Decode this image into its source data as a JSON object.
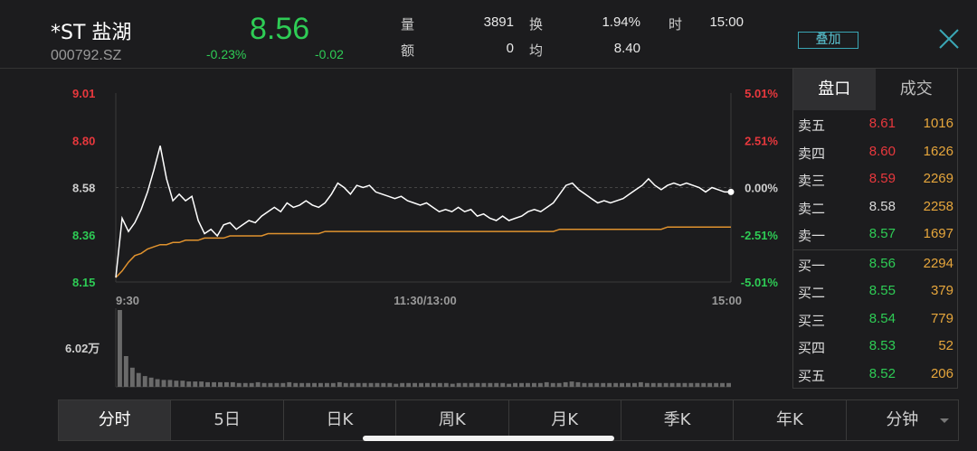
{
  "header": {
    "name": "*ST 盐湖",
    "code": "000792.SZ",
    "price": "8.56",
    "change_pct": "-0.23%",
    "change_abs": "-0.02",
    "stats": {
      "volume_label": "量",
      "volume_value": "3891",
      "amount_label": "额",
      "amount_value": "0",
      "turnover_label": "换",
      "turnover_value": "1.94%",
      "avg_label": "均",
      "avg_value": "8.40",
      "time_label": "时",
      "time_value": "15:00"
    },
    "overlay_label": "叠加"
  },
  "colors": {
    "up": "#e8383d",
    "down": "#2ecc55",
    "neutral": "#d8d8d8",
    "avg_line": "#e0922e",
    "price_line": "#ffffff"
  },
  "chart": {
    "price_ticks": [
      "9.01",
      "8.80",
      "8.58",
      "8.36",
      "8.15"
    ],
    "pct_ticks": [
      "5.01%",
      "2.51%",
      "0.00%",
      "-2.51%",
      "-5.01%"
    ],
    "time_ticks": [
      "9:30",
      "11:30/13:00",
      "15:00"
    ],
    "volume_max_label": "6.02万"
  },
  "chart_data": {
    "type": "line",
    "title": "",
    "xlabel": "",
    "ylabel": "",
    "ylim": [
      8.15,
      9.01
    ],
    "prev_close": 8.58,
    "series": [
      {
        "values": [
          8.17,
          8.44,
          8.38,
          8.42,
          8.48,
          8.56,
          8.66,
          8.77,
          8.62,
          8.52,
          8.55,
          8.52,
          8.54,
          8.43,
          8.37,
          8.39,
          8.36,
          8.41,
          8.42,
          8.39,
          8.41,
          8.43,
          8.42,
          8.45,
          8.47,
          8.49,
          8.47,
          8.51,
          8.49,
          8.5,
          8.52,
          8.5,
          8.49,
          8.51,
          8.55,
          8.6,
          8.58,
          8.55,
          8.59,
          8.58,
          8.59,
          8.56,
          8.55,
          8.54,
          8.53,
          8.54,
          8.52,
          8.51,
          8.5,
          8.51,
          8.49,
          8.47,
          8.48,
          8.47,
          8.49,
          8.47,
          8.48,
          8.45,
          8.46,
          8.44,
          8.43,
          8.45,
          8.43,
          8.44,
          8.45,
          8.47,
          8.48,
          8.47,
          8.49,
          8.51,
          8.55,
          8.59,
          8.6,
          8.57,
          8.55,
          8.53,
          8.51,
          8.52,
          8.51,
          8.52,
          8.53,
          8.55,
          8.57,
          8.59,
          8.62,
          8.59,
          8.57,
          8.59,
          8.6,
          8.59,
          8.6,
          8.59,
          8.58,
          8.56,
          8.58,
          8.57,
          8.56,
          8.56
        ]
      },
      {
        "values": [
          8.17,
          8.2,
          8.24,
          8.27,
          8.28,
          8.3,
          8.31,
          8.32,
          8.32,
          8.33,
          8.33,
          8.34,
          8.34,
          8.34,
          8.35,
          8.35,
          8.35,
          8.35,
          8.36,
          8.36,
          8.36,
          8.36,
          8.36,
          8.36,
          8.37,
          8.37,
          8.37,
          8.37,
          8.37,
          8.37,
          8.37,
          8.37,
          8.37,
          8.38,
          8.38,
          8.38,
          8.38,
          8.38,
          8.38,
          8.38,
          8.38,
          8.38,
          8.38,
          8.38,
          8.38,
          8.38,
          8.38,
          8.38,
          8.38,
          8.38,
          8.38,
          8.38,
          8.38,
          8.38,
          8.38,
          8.38,
          8.38,
          8.38,
          8.38,
          8.38,
          8.38,
          8.38,
          8.38,
          8.38,
          8.38,
          8.38,
          8.38,
          8.38,
          8.38,
          8.38,
          8.39,
          8.39,
          8.39,
          8.39,
          8.39,
          8.39,
          8.39,
          8.39,
          8.39,
          8.39,
          8.39,
          8.39,
          8.39,
          8.39,
          8.39,
          8.39,
          8.39,
          8.4,
          8.4,
          8.4,
          8.4,
          8.4,
          8.4,
          8.4,
          8.4,
          8.4,
          8.4,
          8.4
        ]
      }
    ],
    "volume": [
      100,
      40,
      25,
      18,
      14,
      12,
      10,
      9,
      9,
      8,
      8,
      7,
      7,
      7,
      6,
      6,
      6,
      6,
      6,
      5,
      5,
      5,
      6,
      5,
      5,
      5,
      5,
      6,
      5,
      5,
      5,
      5,
      5,
      5,
      5,
      6,
      5,
      5,
      5,
      5,
      5,
      5,
      5,
      5,
      4,
      5,
      5,
      5,
      5,
      5,
      5,
      5,
      5,
      4,
      5,
      5,
      5,
      5,
      5,
      5,
      5,
      5,
      4,
      5,
      5,
      5,
      5,
      5,
      6,
      5,
      5,
      6,
      7,
      6,
      5,
      5,
      5,
      5,
      5,
      5,
      5,
      5,
      5,
      6,
      5,
      5,
      5,
      5,
      5,
      5,
      5,
      5,
      5,
      5,
      5,
      5,
      5,
      5
    ]
  },
  "orderbook": {
    "tabs": [
      "盘口",
      "成交"
    ],
    "asks": [
      {
        "label": "卖五",
        "price": "8.61",
        "vol": "1016",
        "dir": "up"
      },
      {
        "label": "卖四",
        "price": "8.60",
        "vol": "1626",
        "dir": "up"
      },
      {
        "label": "卖三",
        "price": "8.59",
        "vol": "2269",
        "dir": "up"
      },
      {
        "label": "卖二",
        "price": "8.58",
        "vol": "2258",
        "dir": "neutral"
      },
      {
        "label": "卖一",
        "price": "8.57",
        "vol": "1697",
        "dir": "down"
      }
    ],
    "bids": [
      {
        "label": "买一",
        "price": "8.56",
        "vol": "2294",
        "dir": "down"
      },
      {
        "label": "买二",
        "price": "8.55",
        "vol": "379",
        "dir": "down"
      },
      {
        "label": "买三",
        "price": "8.54",
        "vol": "779",
        "dir": "down"
      },
      {
        "label": "买四",
        "price": "8.53",
        "vol": "52",
        "dir": "down"
      },
      {
        "label": "买五",
        "price": "8.52",
        "vol": "206",
        "dir": "down"
      }
    ]
  },
  "periods": [
    "分时",
    "5日",
    "日K",
    "周K",
    "月K",
    "季K",
    "年K",
    "分钟"
  ]
}
